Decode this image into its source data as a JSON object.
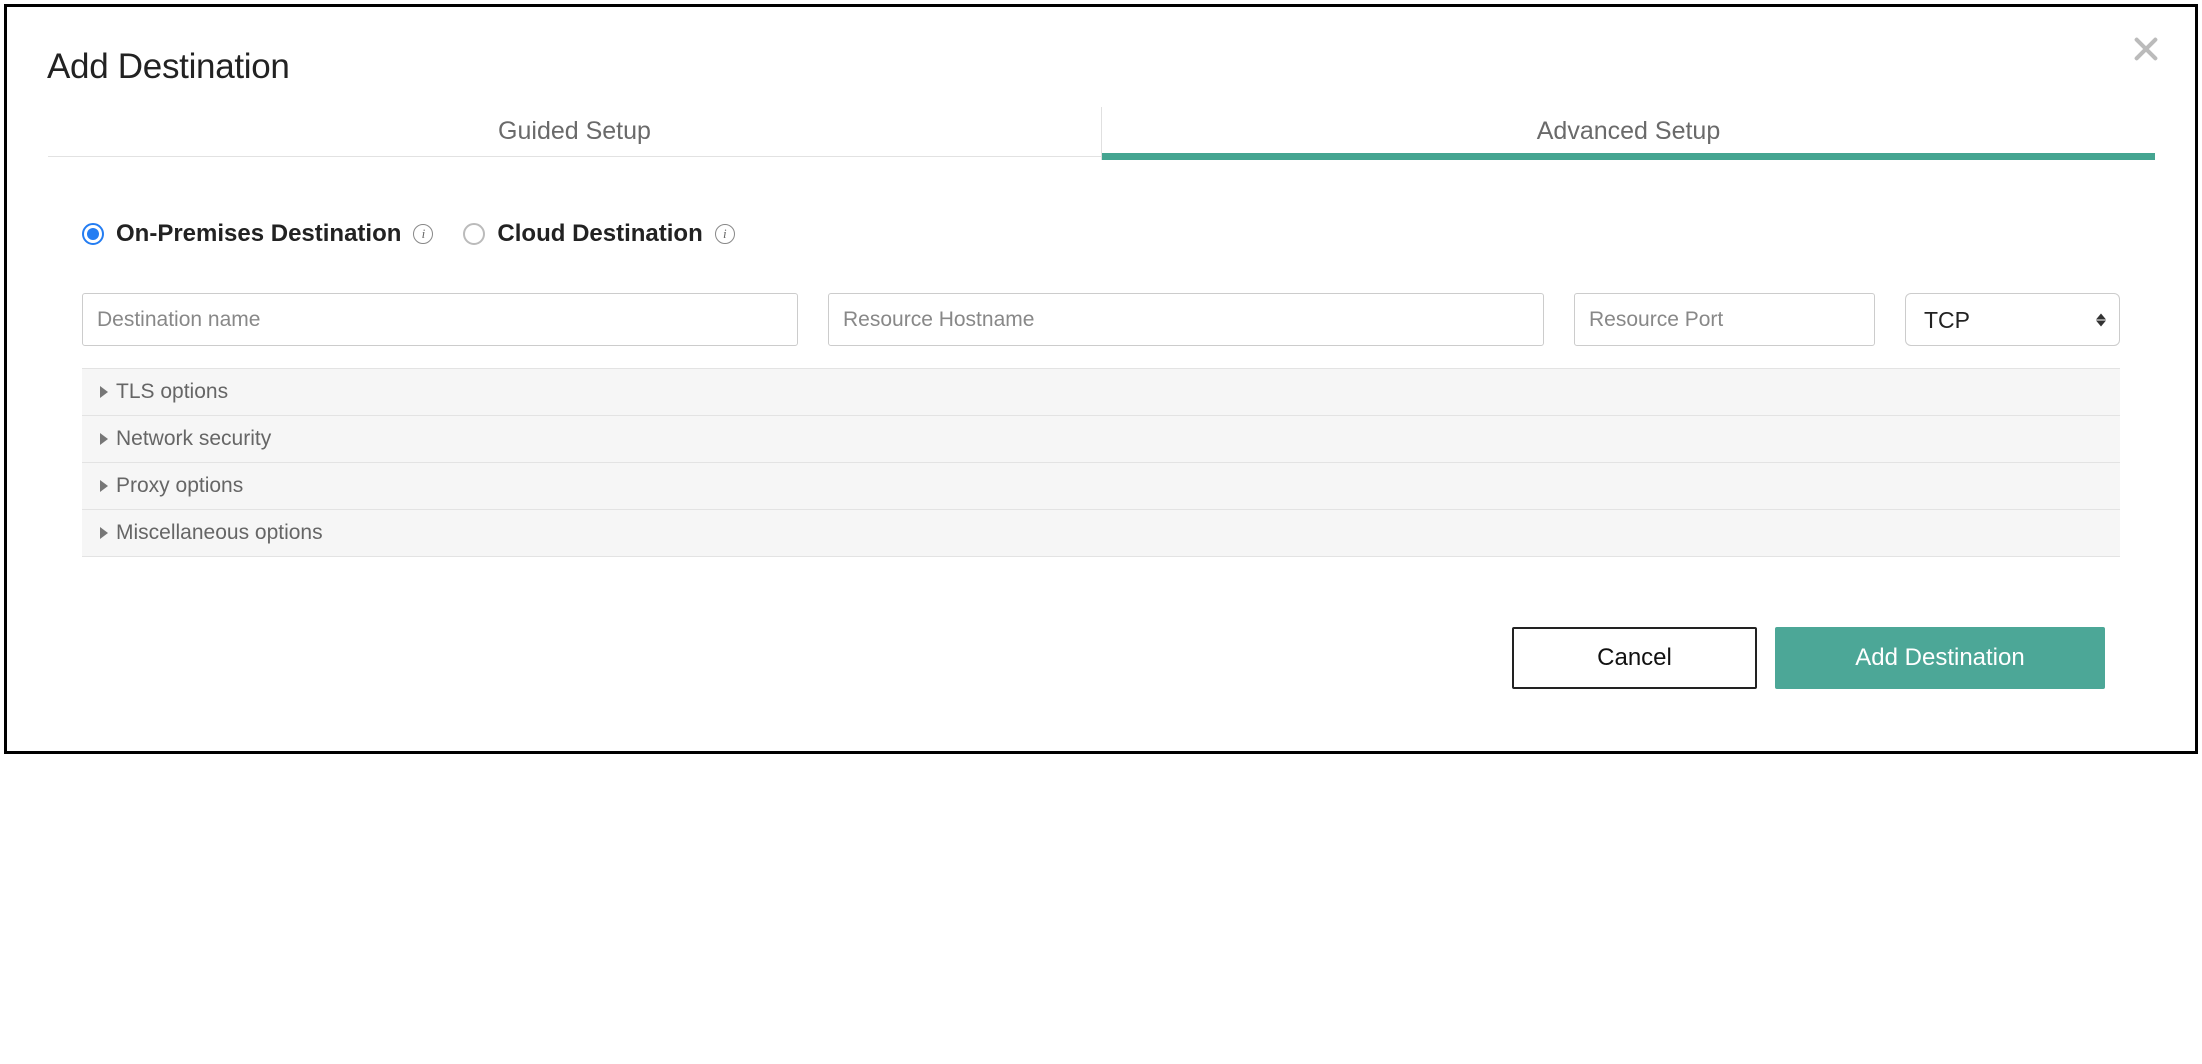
{
  "title": "Add Destination",
  "tabs": {
    "guided": "Guided Setup",
    "advanced": "Advanced Setup"
  },
  "radios": {
    "onprem": "On-Premises Destination",
    "cloud": "Cloud Destination"
  },
  "inputs": {
    "dest_name_placeholder": "Destination name",
    "hostname_placeholder": "Resource Hostname",
    "port_placeholder": "Resource Port",
    "protocol_value": "TCP"
  },
  "accordion": {
    "tls": "TLS options",
    "network": "Network security",
    "proxy": "Proxy options",
    "misc": "Miscellaneous options"
  },
  "buttons": {
    "cancel": "Cancel",
    "add": "Add Destination"
  }
}
